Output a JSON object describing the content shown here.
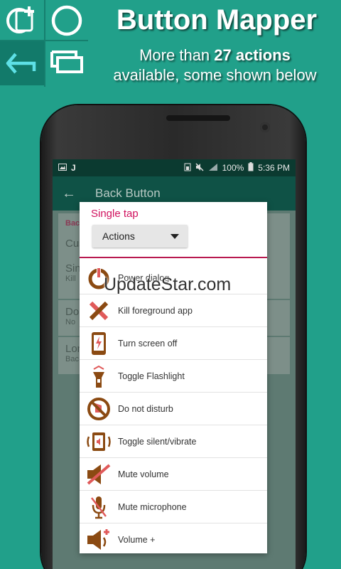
{
  "header": {
    "title": "Button Mapper",
    "subtitle_part1": "More than ",
    "subtitle_bold": "27 actions",
    "subtitle_part2": "available, some shown below"
  },
  "top_icons": [
    "add-app-icon",
    "circle-home-icon",
    "back-arrow-icon",
    "recents-icon"
  ],
  "status_bar": {
    "left_text": "J",
    "battery": "100%",
    "time": "5:36 PM"
  },
  "app_bar": {
    "title": "Back Button"
  },
  "background_cards": [
    {
      "title": "Bac",
      "sub": ""
    },
    {
      "title": "Cus",
      "sub": ""
    },
    {
      "title": "Sin",
      "sub": "Kill"
    },
    {
      "title": "Dou",
      "sub": "No"
    },
    {
      "title": "Lon",
      "sub": "Bac"
    }
  ],
  "dialog": {
    "title": "Single tap",
    "select_value": "Actions",
    "actions": [
      {
        "label": "Power dialog",
        "icon": "power-icon"
      },
      {
        "label": "Kill foreground app",
        "icon": "kill-x-icon"
      },
      {
        "label": "Turn screen off",
        "icon": "phone-bolt-icon"
      },
      {
        "label": "Toggle Flashlight",
        "icon": "flashlight-icon"
      },
      {
        "label": "Do not disturb",
        "icon": "do-not-disturb-icon"
      },
      {
        "label": "Toggle silent/vibrate",
        "icon": "vibrate-icon"
      },
      {
        "label": "Mute volume",
        "icon": "mute-volume-icon"
      },
      {
        "label": "Mute microphone",
        "icon": "mute-microphone-icon"
      },
      {
        "label": "Volume +",
        "icon": "volume-up-icon"
      }
    ]
  },
  "watermark": "UpdateStar.com",
  "colors": {
    "background": "#21a08a",
    "accent": "#d0115e",
    "icon_brown": "#8b4a12",
    "icon_red": "#e05a5a"
  }
}
